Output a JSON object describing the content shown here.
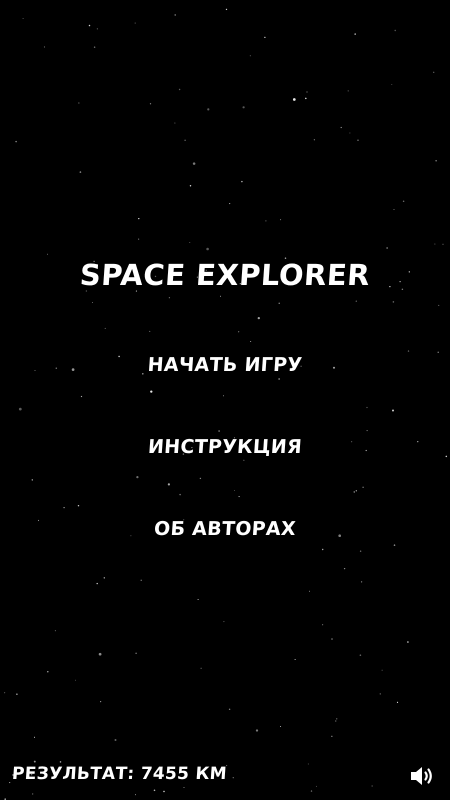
{
  "game": {
    "title": "SPACE EXPLORER",
    "menu": {
      "start": "НАЧАТЬ ИГРУ",
      "instructions": "ИНСТРУКЦИЯ",
      "authors": "ОБ АВТОРАХ"
    },
    "score_label": "РЕЗУЛЬТАТ: 7455 КМ",
    "sound_icon": "speaker-icon"
  },
  "colors": {
    "background": "#000000",
    "text": "#ffffff",
    "star": "#ffffff"
  }
}
